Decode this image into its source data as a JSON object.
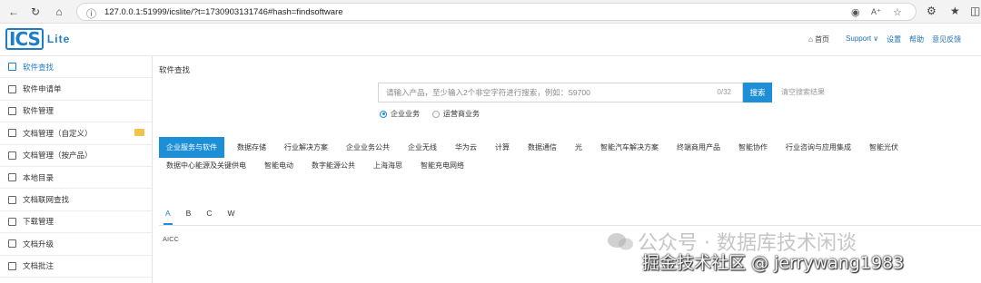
{
  "browser": {
    "url_host": "127.0.0.1",
    "url_rest": ":51999/icslite/?t=1730903131746#hash=findsoftware"
  },
  "header": {
    "logo_mark": "ICS",
    "logo_text": "Lite",
    "links": [
      "首页",
      "Support ∨",
      "设置",
      "帮助",
      "意见反馈"
    ]
  },
  "sidebar": {
    "items": [
      {
        "label": "软件查找",
        "icon": "search-doc-icon",
        "active": true
      },
      {
        "label": "软件申请单",
        "icon": "edit-icon"
      },
      {
        "label": "软件管理",
        "icon": "grid-icon"
      },
      {
        "label": "文档管理（自定义）",
        "icon": "edit-doc-icon"
      },
      {
        "label": "文档管理（按产品）",
        "icon": "edit-doc-icon"
      },
      {
        "label": "本地目录",
        "icon": "list-icon"
      },
      {
        "label": "文档联网查找",
        "icon": "search-doc-icon"
      },
      {
        "label": "下载管理",
        "icon": "download-icon"
      },
      {
        "label": "文档升级",
        "icon": "upgrade-icon"
      },
      {
        "label": "文档批注",
        "icon": "comment-icon"
      }
    ]
  },
  "main": {
    "title": "软件查找",
    "search_placeholder": "请输入产品，至少输入2个非空字符进行搜索，例如：S9700",
    "counter": "0/32",
    "search_button": "搜索",
    "clear_link": "清空搜索结果",
    "radios": [
      "企业业务",
      "运营商业务"
    ],
    "categories_row1": [
      "企业服务与软件",
      "数据存储",
      "行业解决方案",
      "企业业务公共",
      "企业无线",
      "华为云",
      "计算",
      "数据通信",
      "光",
      "智能汽车解决方案",
      "终端商用产品",
      "智能协作",
      "行业咨询与应用集成",
      "智能光伏"
    ],
    "categories_row2": [
      "数据中心能源及关键供电",
      "智能电动",
      "数字能源公共",
      "上海海思",
      "智能充电网络"
    ],
    "letters": [
      "A",
      "B",
      "C",
      "W"
    ],
    "result": "AICC"
  },
  "watermark": {
    "line1": "公众号 · 数据库技术闲谈",
    "line2": "掘金技术社区 @ jerrywang1983"
  }
}
